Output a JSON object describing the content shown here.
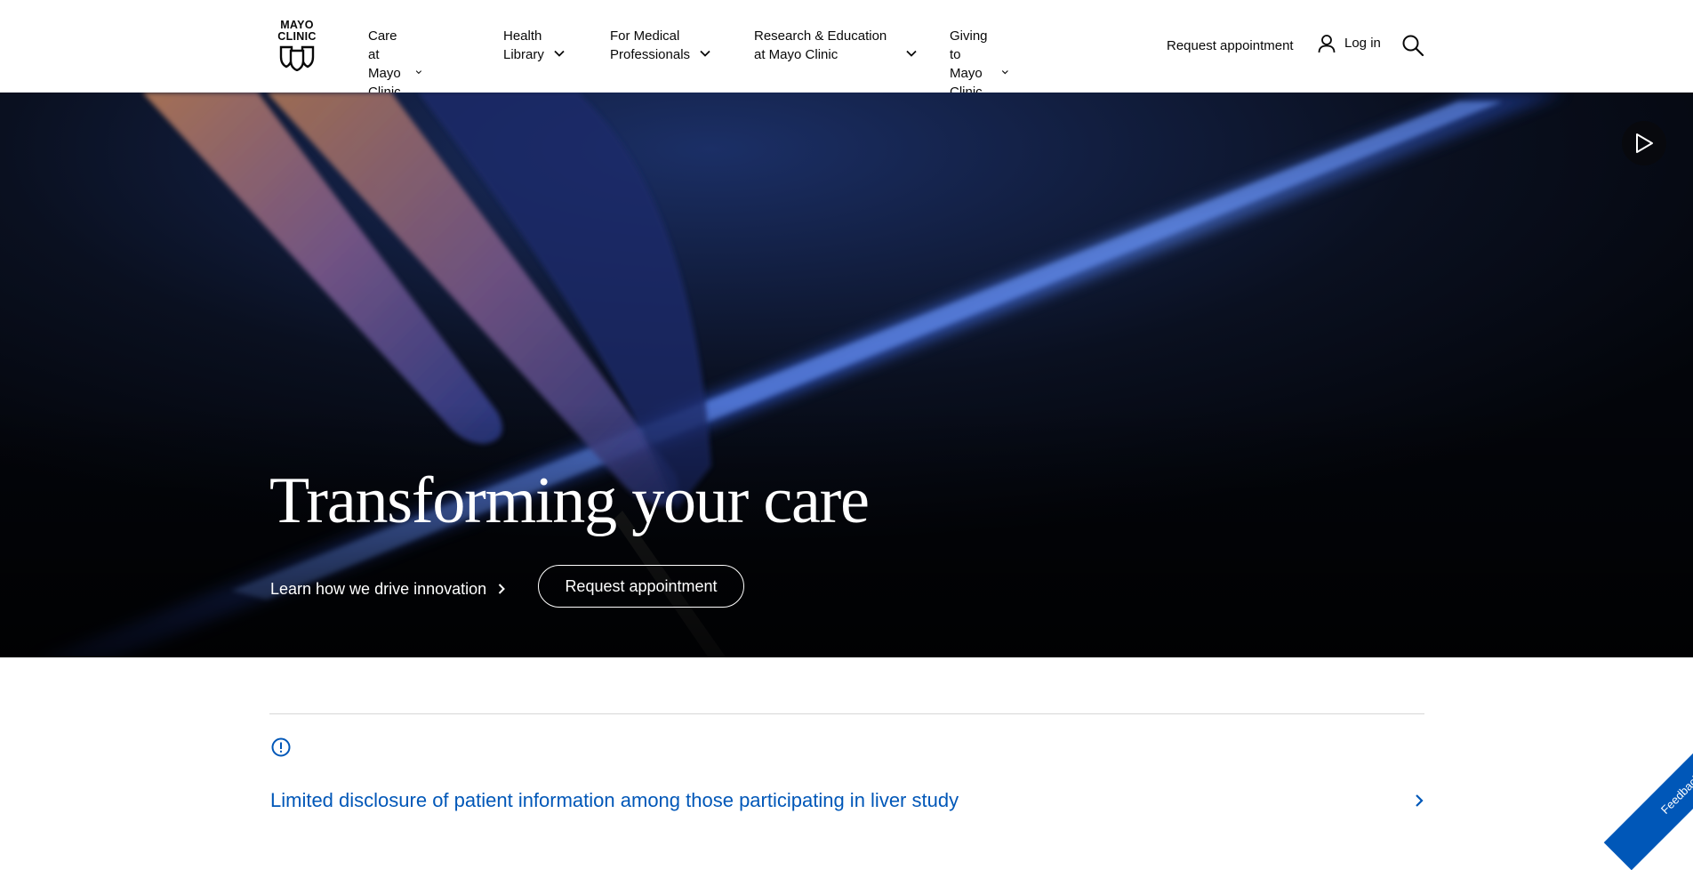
{
  "brand": {
    "logo_line1": "MAYO",
    "logo_line2": "CLINIC"
  },
  "nav": {
    "items": [
      {
        "line1": "Care at",
        "line2": "Mayo Clinic"
      },
      {
        "line1": "Health",
        "line2": "Library"
      },
      {
        "line1": "For Medical",
        "line2": "Professionals"
      },
      {
        "line1": "Research & Education",
        "line2": "at Mayo Clinic"
      },
      {
        "line1": "Giving to",
        "line2": "Mayo Clinic"
      }
    ]
  },
  "utility": {
    "request_label": "Request appointment",
    "login_label": "Log in"
  },
  "hero": {
    "title": "Transforming your care",
    "link_label": "Learn how we drive innovation",
    "button_label": "Request appointment"
  },
  "alert": {
    "text": "Limited disclosure of patient information among those participating in liver study"
  },
  "feedback": {
    "label": "Feedback"
  },
  "colors": {
    "link_blue": "#0057b8",
    "hero_bg": "#05070d"
  }
}
